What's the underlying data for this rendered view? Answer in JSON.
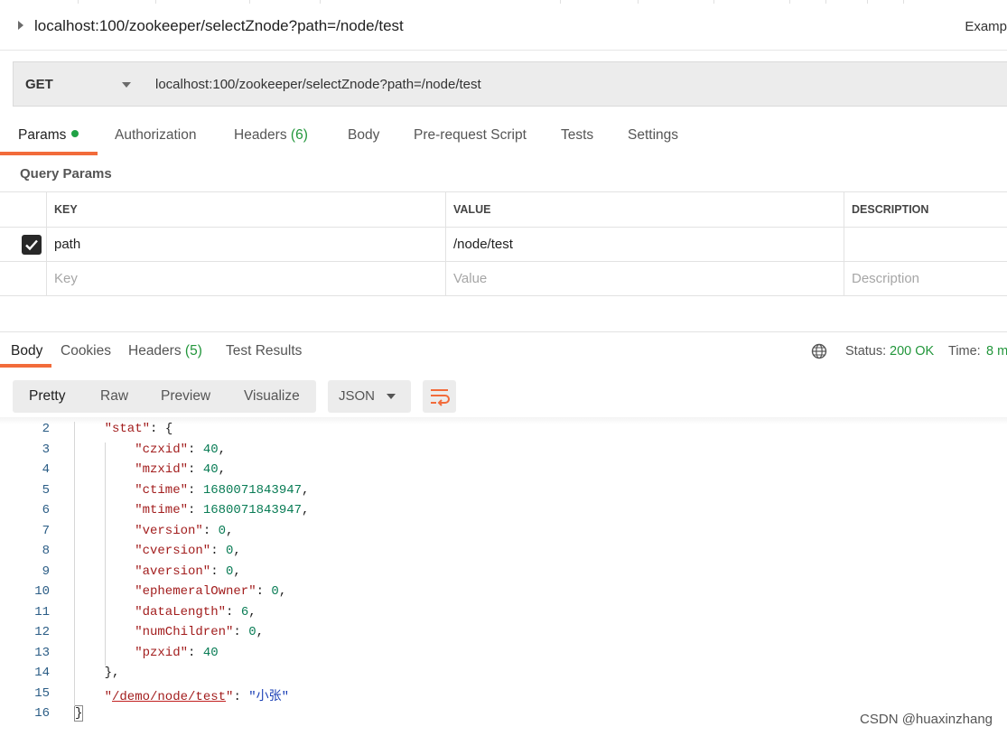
{
  "title_row": {
    "url": "localhost:100/zookeeper/selectZnode?path=/node/test",
    "right_label": "Examp"
  },
  "request": {
    "method": "GET",
    "url": "localhost:100/zookeeper/selectZnode?path=/node/test"
  },
  "request_tabs": {
    "params": "Params",
    "authorization": "Authorization",
    "headers": "Headers",
    "headers_count": "(6)",
    "body": "Body",
    "pre_request": "Pre-request Script",
    "tests": "Tests",
    "settings": "Settings"
  },
  "query_params": {
    "title": "Query Params",
    "columns": [
      "KEY",
      "VALUE",
      "DESCRIPTION"
    ],
    "rows": [
      {
        "checked": true,
        "key": "path",
        "value": "/node/test",
        "description": ""
      }
    ],
    "placeholders": {
      "key": "Key",
      "value": "Value",
      "description": "Description"
    }
  },
  "response_tabs": {
    "body": "Body",
    "cookies": "Cookies",
    "headers": "Headers",
    "headers_count": "(5)",
    "test_results": "Test Results"
  },
  "status": {
    "status_label": "Status:",
    "status_value": "200 OK",
    "time_label": "Time:",
    "time_value": "8 m"
  },
  "view_modes": [
    "Pretty",
    "Raw",
    "Preview",
    "Visualize"
  ],
  "format": "JSON",
  "colors": {
    "accent": "#f26b3a",
    "success": "#22963b"
  },
  "code_lines": [
    {
      "n": "2",
      "tokens": [
        [
          "k",
          "\"stat\""
        ],
        [
          "p",
          ": {"
        ]
      ],
      "indent": 1
    },
    {
      "n": "3",
      "tokens": [
        [
          "k",
          "\"czxid\""
        ],
        [
          "p",
          ": "
        ],
        [
          "num",
          "40"
        ],
        [
          "p",
          ","
        ]
      ],
      "indent": 2
    },
    {
      "n": "4",
      "tokens": [
        [
          "k",
          "\"mzxid\""
        ],
        [
          "p",
          ": "
        ],
        [
          "num",
          "40"
        ],
        [
          "p",
          ","
        ]
      ],
      "indent": 2
    },
    {
      "n": "5",
      "tokens": [
        [
          "k",
          "\"ctime\""
        ],
        [
          "p",
          ": "
        ],
        [
          "num",
          "1680071843947"
        ],
        [
          "p",
          ","
        ]
      ],
      "indent": 2
    },
    {
      "n": "6",
      "tokens": [
        [
          "k",
          "\"mtime\""
        ],
        [
          "p",
          ": "
        ],
        [
          "num",
          "1680071843947"
        ],
        [
          "p",
          ","
        ]
      ],
      "indent": 2
    },
    {
      "n": "7",
      "tokens": [
        [
          "k",
          "\"version\""
        ],
        [
          "p",
          ": "
        ],
        [
          "num",
          "0"
        ],
        [
          "p",
          ","
        ]
      ],
      "indent": 2
    },
    {
      "n": "8",
      "tokens": [
        [
          "k",
          "\"cversion\""
        ],
        [
          "p",
          ": "
        ],
        [
          "num",
          "0"
        ],
        [
          "p",
          ","
        ]
      ],
      "indent": 2
    },
    {
      "n": "9",
      "tokens": [
        [
          "k",
          "\"aversion\""
        ],
        [
          "p",
          ": "
        ],
        [
          "num",
          "0"
        ],
        [
          "p",
          ","
        ]
      ],
      "indent": 2
    },
    {
      "n": "10",
      "tokens": [
        [
          "k",
          "\"ephemeralOwner\""
        ],
        [
          "p",
          ": "
        ],
        [
          "num",
          "0"
        ],
        [
          "p",
          ","
        ]
      ],
      "indent": 2
    },
    {
      "n": "11",
      "tokens": [
        [
          "k",
          "\"dataLength\""
        ],
        [
          "p",
          ": "
        ],
        [
          "num",
          "6"
        ],
        [
          "p",
          ","
        ]
      ],
      "indent": 2
    },
    {
      "n": "12",
      "tokens": [
        [
          "k",
          "\"numChildren\""
        ],
        [
          "p",
          ": "
        ],
        [
          "num",
          "0"
        ],
        [
          "p",
          ","
        ]
      ],
      "indent": 2
    },
    {
      "n": "13",
      "tokens": [
        [
          "k",
          "\"pzxid\""
        ],
        [
          "p",
          ": "
        ],
        [
          "num",
          "40"
        ]
      ],
      "indent": 2
    },
    {
      "n": "14",
      "tokens": [
        [
          "p",
          "},"
        ]
      ],
      "indent": 1
    },
    {
      "n": "15",
      "tokens": [
        [
          "k",
          "\""
        ],
        [
          "link",
          "/demo/node/test"
        ],
        [
          "k",
          "\""
        ],
        [
          "p",
          ": "
        ],
        [
          "str",
          "\"小张\""
        ]
      ],
      "indent": 1
    },
    {
      "n": "16",
      "tokens": [
        [
          "brace",
          "}"
        ]
      ],
      "indent": 0
    }
  ],
  "watermark": "CSDN @huaxinzhang"
}
